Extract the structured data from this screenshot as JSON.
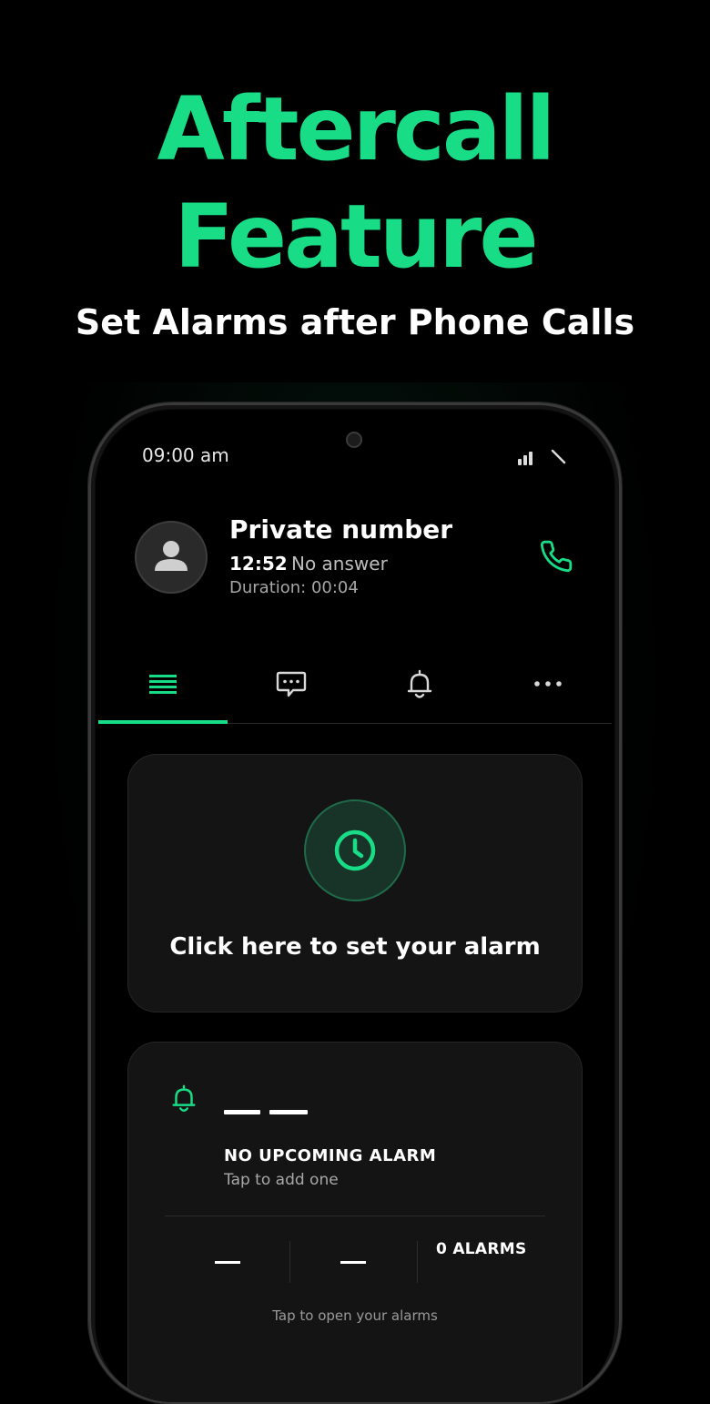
{
  "promo": {
    "title_line1": "Aftercall",
    "title_line2": "Feature",
    "subtitle": "Set Alarms after Phone Calls"
  },
  "colors": {
    "accent": "#19dc86",
    "background": "#000000",
    "card": "#141414"
  },
  "status_bar": {
    "time": "09:00 am",
    "icons": [
      "signal-icon",
      "no-wifi-icon"
    ]
  },
  "call": {
    "caller_name": "Private number",
    "time": "12:52",
    "status": "No answer",
    "duration": "Duration: 00:04",
    "avatar_icon": "person-icon",
    "action_icon": "phone-icon"
  },
  "tabs": [
    {
      "icon": "list-icon",
      "active": true
    },
    {
      "icon": "message-icon",
      "active": false
    },
    {
      "icon": "bell-icon",
      "active": false
    },
    {
      "icon": "more-icon",
      "active": false
    }
  ],
  "set_alarm_card": {
    "icon": "clock-icon",
    "label": "Click here to set your alarm"
  },
  "alarm_summary": {
    "icon": "bell-icon",
    "placeholder": "— —",
    "title": "NO UPCOMING ALARM",
    "subtitle": "Tap to add one",
    "stat1": "—",
    "stat2": "—",
    "count": "0 ALARMS",
    "footer": "Tap to open your alarms"
  }
}
